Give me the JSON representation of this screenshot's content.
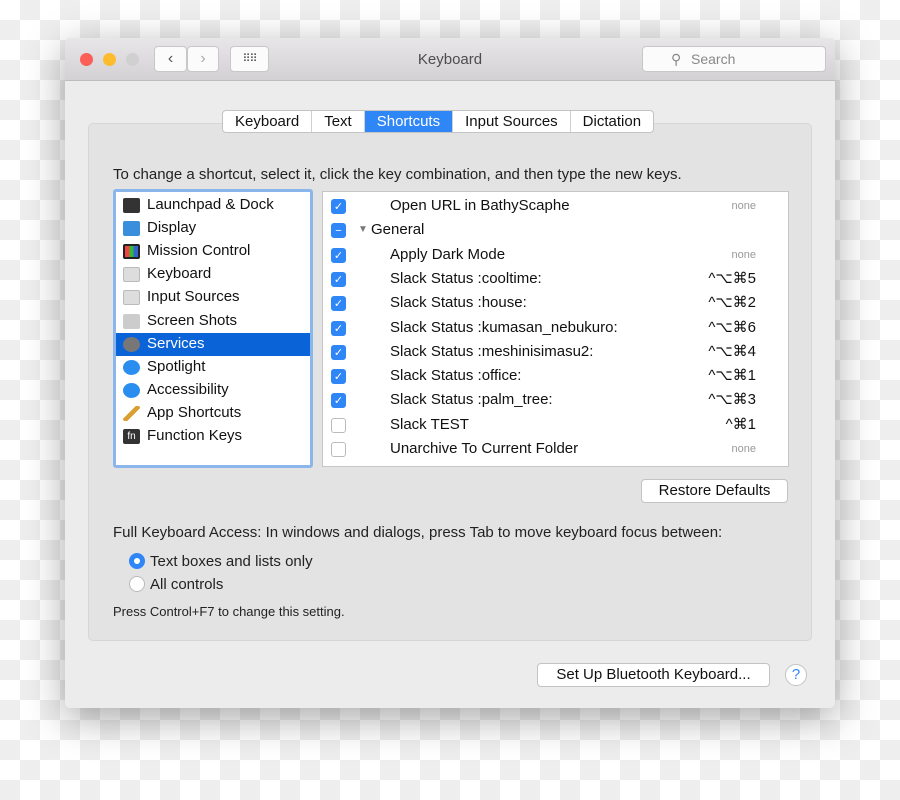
{
  "window": {
    "title": "Keyboard",
    "search_placeholder": "Search"
  },
  "tabs": [
    "Keyboard",
    "Text",
    "Shortcuts",
    "Input Sources",
    "Dictation"
  ],
  "active_tab": "Shortcuts",
  "instruction": "To change a shortcut, select it, click the key combination, and then type the new keys.",
  "categories": [
    {
      "label": "Launchpad & Dock",
      "icon": "launchpad-icon"
    },
    {
      "label": "Display",
      "icon": "display-icon"
    },
    {
      "label": "Mission Control",
      "icon": "mission-control-icon"
    },
    {
      "label": "Keyboard",
      "icon": "keyboard-icon"
    },
    {
      "label": "Input Sources",
      "icon": "keyboard-icon"
    },
    {
      "label": "Screen Shots",
      "icon": "screenshot-icon"
    },
    {
      "label": "Services",
      "icon": "gear-icon",
      "selected": true
    },
    {
      "label": "Spotlight",
      "icon": "spotlight-icon"
    },
    {
      "label": "Accessibility",
      "icon": "accessibility-icon"
    },
    {
      "label": "App Shortcuts",
      "icon": "app-shortcuts-icon"
    },
    {
      "label": "Function Keys",
      "icon": "fn-icon"
    }
  ],
  "shortcuts": [
    {
      "label": "Open URL in BathyScaphe",
      "key": "none",
      "checked": true
    },
    {
      "label": "General",
      "group": true,
      "state": "mixed"
    },
    {
      "label": "Apply Dark Mode",
      "key": "none",
      "checked": true
    },
    {
      "label": "Slack Status :cooltime:",
      "key": "^⌥⌘5",
      "checked": true
    },
    {
      "label": "Slack Status :house:",
      "key": "^⌥⌘2",
      "checked": true
    },
    {
      "label": "Slack Status :kumasan_nebukuro:",
      "key": "^⌥⌘6",
      "checked": true
    },
    {
      "label": "Slack Status :meshinisimasu2:",
      "key": "^⌥⌘4",
      "checked": true
    },
    {
      "label": "Slack Status :office:",
      "key": "^⌥⌘1",
      "checked": true
    },
    {
      "label": "Slack Status :palm_tree:",
      "key": "^⌥⌘3",
      "checked": true
    },
    {
      "label": "Slack TEST",
      "key": "^⌘1",
      "checked": false
    },
    {
      "label": "Unarchive To Current Folder",
      "key": "none",
      "checked": false
    }
  ],
  "restore_defaults": "Restore Defaults",
  "full_access_label": "Full Keyboard Access: In windows and dialogs, press Tab to move keyboard focus between:",
  "radio_options": [
    {
      "label": "Text boxes and lists only",
      "selected": true
    },
    {
      "label": "All controls",
      "selected": false
    }
  ],
  "hint": "Press Control+F7 to change this setting.",
  "bluetooth_button": "Set Up Bluetooth Keyboard...",
  "help_button": "?",
  "colors": {
    "accent": "#2f86f6",
    "selection": "#0a64d8"
  }
}
